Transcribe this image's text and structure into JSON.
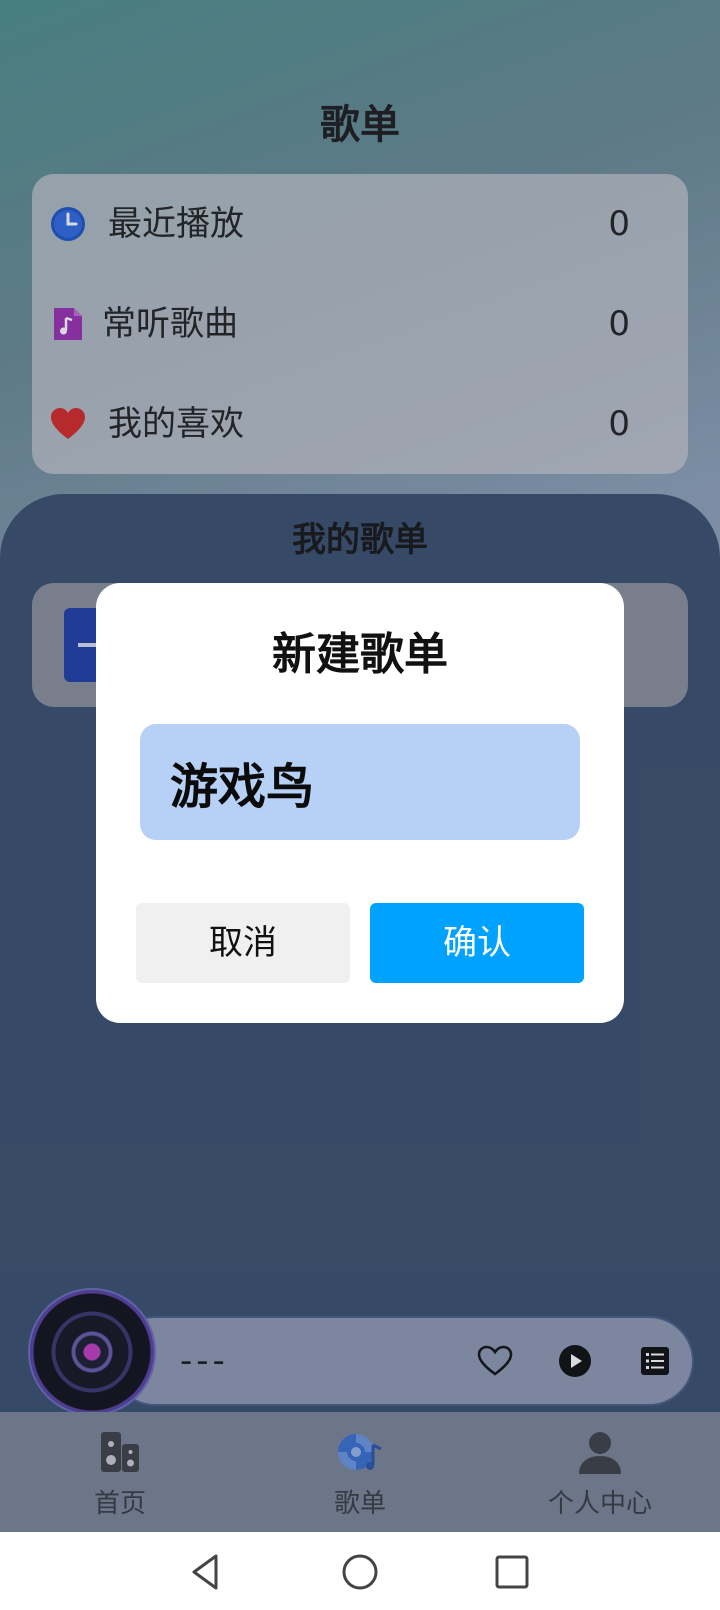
{
  "page": {
    "title": "歌单"
  },
  "presets": [
    {
      "label": "最近播放",
      "count": "0",
      "icon": "clock-icon"
    },
    {
      "label": "常听歌曲",
      "count": "0",
      "icon": "music-file-icon"
    },
    {
      "label": "我的喜欢",
      "count": "0",
      "icon": "heart-icon"
    }
  ],
  "my_playlists": {
    "title": "我的歌单"
  },
  "dialog": {
    "title": "新建歌单",
    "input_value": "游戏鸟",
    "cancel_label": "取消",
    "confirm_label": "确认"
  },
  "player": {
    "song_title": "---"
  },
  "bottom_nav": [
    {
      "label": "首页",
      "icon": "speaker-icon"
    },
    {
      "label": "歌单",
      "icon": "playlist-disc-icon",
      "active": true
    },
    {
      "label": "个人中心",
      "icon": "person-icon"
    }
  ],
  "colors": {
    "accent": "#00a2ff",
    "input_bg": "#b6d1f5",
    "panel": "#3a506e"
  }
}
